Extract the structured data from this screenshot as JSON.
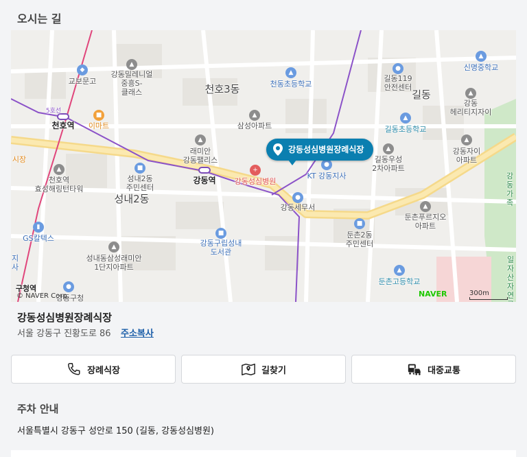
{
  "section_title": "오시는 길",
  "map": {
    "marker_label": "강동성심병원장례식장",
    "labels": {
      "gangdong_millennium": "강동밀레니얼\n중흥S-\n클래스",
      "kyobo": "교보문고",
      "cheonho3": "천호3동",
      "cheondong_school": "천동초등학교",
      "gildong119": "길동119\n안전센터",
      "gildong": "길동",
      "sinmyeong": "신명중학교",
      "gangdong_hillstate": "강동\n헤리티지자이",
      "cheonho_station": "천호역",
      "emart": "이마트",
      "samsung_apt": "삼성아파트",
      "gildong_school": "길동초등학교",
      "raemian": "래미안\n강동팰리스",
      "gangdong_station": "강동역",
      "gangdong_hospital": "강동성심병원",
      "kt": "KT 강동지사",
      "gildong_woosung": "길동우성\n2차아파트",
      "gangdong_xi": "강동자이\n아파트",
      "cheonho_hyosung": "천호역\n효성해링턴타워",
      "seongnae2_center": "성내2동\n주민센터",
      "seongnae2": "성내2동",
      "tax_office": "강동세무서",
      "dunchon_prugio": "둔촌푸르지오\n아파트",
      "gs_caltex": "GS칼텍스",
      "library": "강동구립성내\n도서관",
      "dunchon2_center": "둔촌2동\n주민센터",
      "seongnae_raemian": "성내동삼성래미안\n1단지아파트",
      "dunchon_school": "둔촌고등학교",
      "ilja_park": "일자산\n자연공",
      "gangdong_gu": "강동구청",
      "gucheong_station": "구청역",
      "gangdong_edge": "강동\n가족",
      "line5": "5호선",
      "left_edge1": "시장",
      "left_edge2": "지\n사"
    },
    "naver": "NAVER",
    "copyright": "© NAVER Corp.",
    "scale": "300m"
  },
  "place": {
    "name": "강동성심병원장례식장",
    "address": "서울 강동구 진황도로 86",
    "copy_label": "주소복사"
  },
  "buttons": {
    "funeral": "장례식장",
    "directions": "길찾기",
    "transit": "대중교통"
  },
  "parking": {
    "title": "주차 안내",
    "address": "서울특별시 강동구 성안로 150 (길동, 강동성심병원)"
  }
}
